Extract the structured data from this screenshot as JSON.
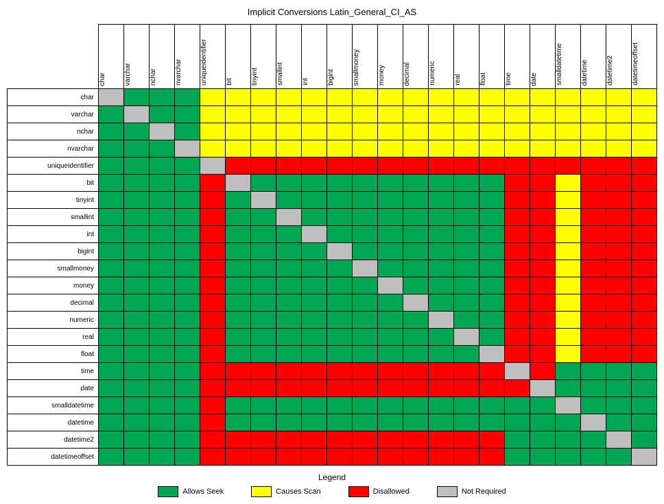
{
  "title": "Implicit Conversions Latin_General_CI_AS",
  "legend_title": "Legend",
  "legend": [
    {
      "code": "G",
      "label": "Allows Seek"
    },
    {
      "code": "Y",
      "label": "Causes Scan"
    },
    {
      "code": "R",
      "label": "Disallowed"
    },
    {
      "code": "N",
      "label": "Not Required"
    }
  ],
  "chart_data": {
    "type": "heatmap",
    "title": "Implicit Conversions Latin_General_CI_AS",
    "categories": {
      "G": "Allows Seek",
      "Y": "Causes Scan",
      "R": "Disallowed",
      "N": "Not Required"
    },
    "columns": [
      "char",
      "varchar",
      "nchar",
      "nvarchar",
      "uniqueidentifier",
      "bit",
      "tinyint",
      "smallint",
      "int",
      "bigint",
      "smallmoney",
      "money",
      "decimal",
      "numeric",
      "real",
      "float",
      "time",
      "date",
      "smalldatetime",
      "datetime",
      "datetime2",
      "datetimeoffset"
    ],
    "rows": [
      "char",
      "varchar",
      "nchar",
      "nvarchar",
      "uniqueidentifier",
      "bit",
      "tinyint",
      "smallint",
      "int",
      "bigint",
      "smallmoney",
      "money",
      "decimal",
      "numeric",
      "real",
      "float",
      "time",
      "date",
      "smalldatetime",
      "datetime",
      "datetime2",
      "datetimeoffset"
    ],
    "matrix": [
      [
        "N",
        "G",
        "G",
        "G",
        "Y",
        "Y",
        "Y",
        "Y",
        "Y",
        "Y",
        "Y",
        "Y",
        "Y",
        "Y",
        "Y",
        "Y",
        "Y",
        "Y",
        "Y",
        "Y",
        "Y",
        "Y"
      ],
      [
        "G",
        "N",
        "G",
        "G",
        "Y",
        "Y",
        "Y",
        "Y",
        "Y",
        "Y",
        "Y",
        "Y",
        "Y",
        "Y",
        "Y",
        "Y",
        "Y",
        "Y",
        "Y",
        "Y",
        "Y",
        "Y"
      ],
      [
        "G",
        "G",
        "N",
        "G",
        "Y",
        "Y",
        "Y",
        "Y",
        "Y",
        "Y",
        "Y",
        "Y",
        "Y",
        "Y",
        "Y",
        "Y",
        "Y",
        "Y",
        "Y",
        "Y",
        "Y",
        "Y"
      ],
      [
        "G",
        "G",
        "G",
        "N",
        "Y",
        "Y",
        "Y",
        "Y",
        "Y",
        "Y",
        "Y",
        "Y",
        "Y",
        "Y",
        "Y",
        "Y",
        "Y",
        "Y",
        "Y",
        "Y",
        "Y",
        "Y"
      ],
      [
        "G",
        "G",
        "G",
        "G",
        "N",
        "R",
        "R",
        "R",
        "R",
        "R",
        "R",
        "R",
        "R",
        "R",
        "R",
        "R",
        "R",
        "R",
        "R",
        "R",
        "R",
        "R"
      ],
      [
        "G",
        "G",
        "G",
        "G",
        "R",
        "N",
        "G",
        "G",
        "G",
        "G",
        "G",
        "G",
        "G",
        "G",
        "G",
        "G",
        "R",
        "R",
        "Y",
        "R",
        "R",
        "R"
      ],
      [
        "G",
        "G",
        "G",
        "G",
        "R",
        "G",
        "N",
        "G",
        "G",
        "G",
        "G",
        "G",
        "G",
        "G",
        "G",
        "G",
        "R",
        "R",
        "Y",
        "R",
        "R",
        "R"
      ],
      [
        "G",
        "G",
        "G",
        "G",
        "R",
        "G",
        "G",
        "N",
        "G",
        "G",
        "G",
        "G",
        "G",
        "G",
        "G",
        "G",
        "R",
        "R",
        "Y",
        "R",
        "R",
        "R"
      ],
      [
        "G",
        "G",
        "G",
        "G",
        "R",
        "G",
        "G",
        "G",
        "N",
        "G",
        "G",
        "G",
        "G",
        "G",
        "G",
        "G",
        "R",
        "R",
        "Y",
        "R",
        "R",
        "R"
      ],
      [
        "G",
        "G",
        "G",
        "G",
        "R",
        "G",
        "G",
        "G",
        "G",
        "N",
        "G",
        "G",
        "G",
        "G",
        "G",
        "G",
        "R",
        "R",
        "Y",
        "R",
        "R",
        "R"
      ],
      [
        "G",
        "G",
        "G",
        "G",
        "R",
        "G",
        "G",
        "G",
        "G",
        "G",
        "N",
        "G",
        "G",
        "G",
        "G",
        "G",
        "R",
        "R",
        "Y",
        "R",
        "R",
        "R"
      ],
      [
        "G",
        "G",
        "G",
        "G",
        "R",
        "G",
        "G",
        "G",
        "G",
        "G",
        "G",
        "N",
        "G",
        "G",
        "G",
        "G",
        "R",
        "R",
        "Y",
        "R",
        "R",
        "R"
      ],
      [
        "G",
        "G",
        "G",
        "G",
        "R",
        "G",
        "G",
        "G",
        "G",
        "G",
        "G",
        "G",
        "N",
        "G",
        "G",
        "G",
        "R",
        "R",
        "Y",
        "R",
        "R",
        "R"
      ],
      [
        "G",
        "G",
        "G",
        "G",
        "R",
        "G",
        "G",
        "G",
        "G",
        "G",
        "G",
        "G",
        "G",
        "N",
        "G",
        "G",
        "R",
        "R",
        "Y",
        "R",
        "R",
        "R"
      ],
      [
        "G",
        "G",
        "G",
        "G",
        "R",
        "G",
        "G",
        "G",
        "G",
        "G",
        "G",
        "G",
        "G",
        "G",
        "N",
        "G",
        "R",
        "R",
        "Y",
        "R",
        "R",
        "R"
      ],
      [
        "G",
        "G",
        "G",
        "G",
        "R",
        "G",
        "G",
        "G",
        "G",
        "G",
        "G",
        "G",
        "G",
        "G",
        "G",
        "N",
        "R",
        "R",
        "Y",
        "R",
        "R",
        "R"
      ],
      [
        "G",
        "G",
        "G",
        "G",
        "R",
        "R",
        "R",
        "R",
        "R",
        "R",
        "R",
        "R",
        "R",
        "R",
        "R",
        "R",
        "N",
        "R",
        "G",
        "G",
        "G",
        "G"
      ],
      [
        "G",
        "G",
        "G",
        "G",
        "R",
        "R",
        "R",
        "R",
        "R",
        "R",
        "R",
        "R",
        "R",
        "R",
        "R",
        "R",
        "R",
        "N",
        "G",
        "G",
        "G",
        "G"
      ],
      [
        "G",
        "G",
        "G",
        "G",
        "R",
        "G",
        "G",
        "G",
        "G",
        "G",
        "G",
        "G",
        "G",
        "G",
        "G",
        "G",
        "G",
        "G",
        "N",
        "G",
        "G",
        "G"
      ],
      [
        "G",
        "G",
        "G",
        "G",
        "R",
        "G",
        "G",
        "G",
        "G",
        "G",
        "G",
        "G",
        "G",
        "G",
        "G",
        "G",
        "G",
        "G",
        "G",
        "N",
        "G",
        "G"
      ],
      [
        "G",
        "G",
        "G",
        "G",
        "R",
        "R",
        "R",
        "R",
        "R",
        "R",
        "R",
        "R",
        "R",
        "R",
        "R",
        "R",
        "G",
        "G",
        "G",
        "G",
        "N",
        "G"
      ],
      [
        "G",
        "G",
        "G",
        "G",
        "R",
        "R",
        "R",
        "R",
        "R",
        "R",
        "R",
        "R",
        "R",
        "R",
        "R",
        "R",
        "G",
        "G",
        "G",
        "G",
        "G",
        "N"
      ]
    ]
  }
}
